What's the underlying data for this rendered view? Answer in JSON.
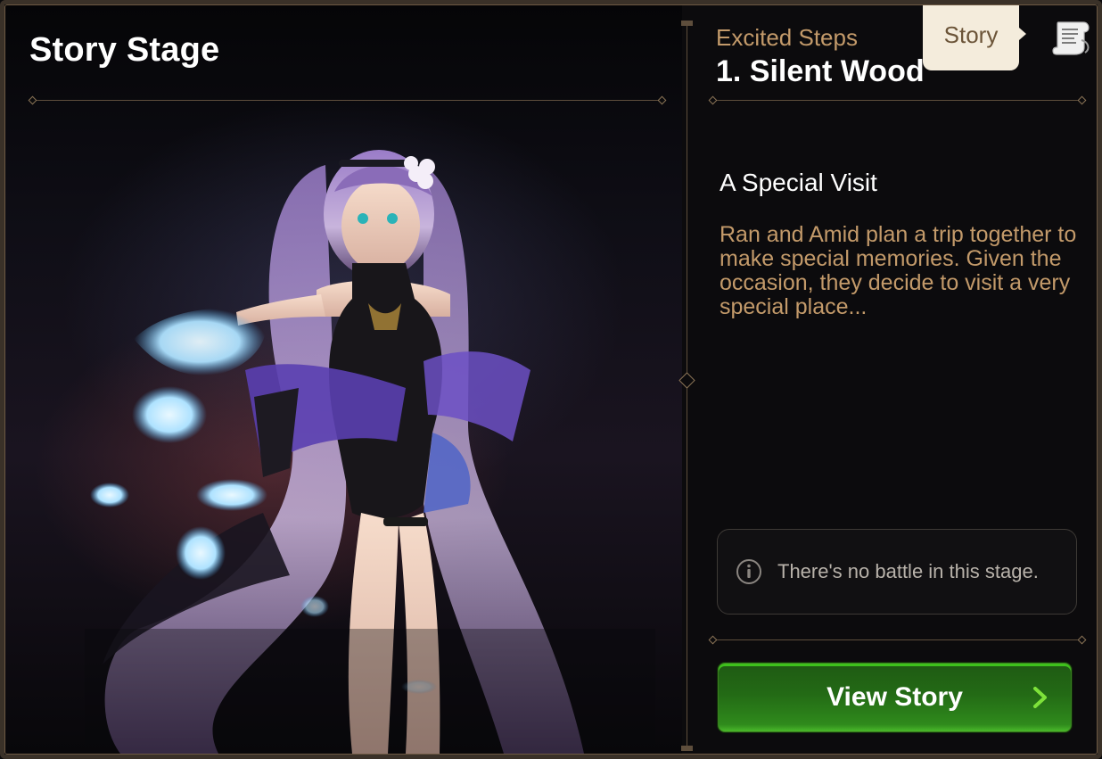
{
  "header": {
    "title": "Story Stage"
  },
  "stage": {
    "chapter": "Excited Steps",
    "name": "1. Silent Wood"
  },
  "tab": {
    "label": "Story",
    "icon": "scroll-icon"
  },
  "story": {
    "title": "A Special Visit",
    "description": "Ran and Amid plan a trip together to make special memories. Given the occasion, they decide to visit a very special place..."
  },
  "notice": {
    "icon": "info-icon",
    "text": "There's no battle in this stage."
  },
  "action": {
    "label": "View Story",
    "icon": "chevron-right-icon"
  },
  "colors": {
    "accent_text": "#c39a6a",
    "button_green": "#2f8a1c",
    "frame_gold": "#6e5a43"
  }
}
